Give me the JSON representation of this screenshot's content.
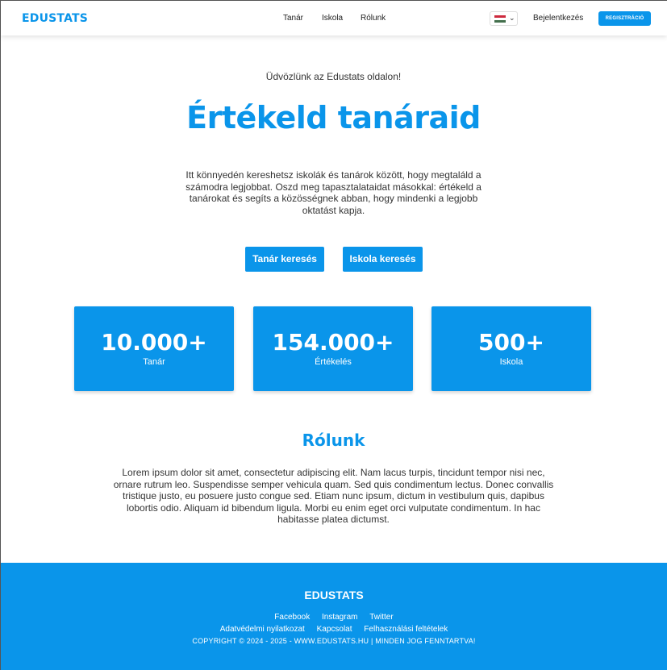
{
  "header": {
    "logo": "EDUSTATS",
    "nav": [
      "Tanár",
      "Iskola",
      "Rólunk"
    ],
    "language_flag": "hungary-flag-icon",
    "login_label": "Bejelentkezés",
    "register_label": "REGISZTRÁCIÓ"
  },
  "hero": {
    "welcome": "Üdvözlünk az Edustats oldalon!",
    "title": "Értékeld tanáraid",
    "description": "Itt könnyedén kereshetsz iskolák és tanárok között, hogy megtaláld a számodra legjobbat. Oszd meg tapasztalataidat másokkal: értékeld a tanárokat és segíts a közösségnek abban, hogy mindenki a legjobb oktatást kapja.",
    "teacher_search_label": "Tanár keresés",
    "school_search_label": "Iskola keresés"
  },
  "stats": [
    {
      "value": "10.000+",
      "label": "Tanár"
    },
    {
      "value": "154.000+",
      "label": "Értékelés"
    },
    {
      "value": "500+",
      "label": "Iskola"
    }
  ],
  "about": {
    "title": "Rólunk",
    "text": "Lorem ipsum dolor sit amet, consectetur adipiscing elit. Nam lacus turpis, tincidunt tempor nisi nec, ornare rutrum leo. Suspendisse semper vehicula quam. Sed quis condimentum lectus. Donec convallis tristique justo, eu posuere justo congue sed. Etiam nunc ipsum, dictum in vestibulum quis, dapibus lobortis odio. Aliquam id bibendum ligula. Morbi eu enim eget orci vulputate condimentum. In hac habitasse platea dictumst."
  },
  "footer": {
    "logo": "EDUSTATS",
    "social_links": [
      "Facebook",
      "Instagram",
      "Twitter"
    ],
    "legal_links": [
      "Adatvédelmi nyilatkozat",
      "Kapcsolat",
      "Felhasználási feltételek"
    ],
    "copyright": "COPYRIGHT © 2024 - 2025 - WWW.EDUSTATS.HU | MINDEN JOG FENNTARTVA!"
  },
  "colors": {
    "accent": "#0a95ea",
    "flag_red": "#cd2a3e",
    "flag_white": "#ffffff",
    "flag_green": "#436f4d"
  }
}
